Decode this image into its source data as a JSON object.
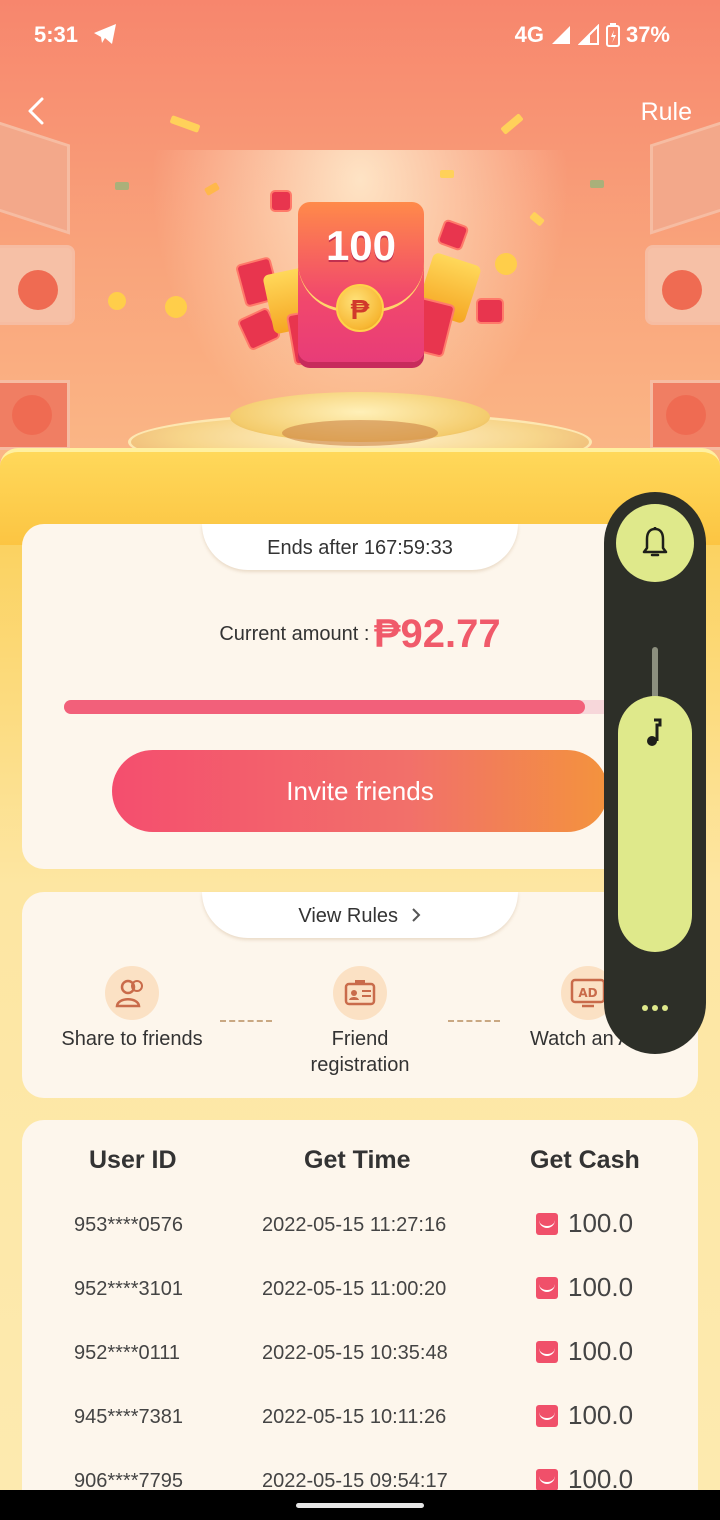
{
  "status_bar": {
    "time": "5:31",
    "network": "4G",
    "battery": "37%"
  },
  "header": {
    "rule_label": "Rule"
  },
  "hero": {
    "envelope_amount": "100",
    "currency_symbol": "₱"
  },
  "countdown": {
    "label": "Ends after  167:59:33"
  },
  "current": {
    "label": "Current amount :",
    "value": "₱92.77",
    "progress_fraction": 0.93
  },
  "invite": {
    "label": "Invite friends"
  },
  "rules": {
    "label": "View Rules",
    "steps": [
      {
        "icon": "users-icon",
        "label": "Share to friends"
      },
      {
        "icon": "id-card-icon",
        "label": "Friend registration"
      },
      {
        "icon": "ad-icon",
        "label": "Watch an AD"
      }
    ]
  },
  "table": {
    "headers": [
      "User ID",
      "Get Time",
      "Get Cash"
    ],
    "rows": [
      {
        "user_id": "953****0576",
        "time": "2022-05-15 11:27:16",
        "cash": "100.0"
      },
      {
        "user_id": "952****3101",
        "time": "2022-05-15 11:00:20",
        "cash": "100.0"
      },
      {
        "user_id": "952****0111",
        "time": "2022-05-15 10:35:48",
        "cash": "100.0"
      },
      {
        "user_id": "945****7381",
        "time": "2022-05-15 10:11:26",
        "cash": "100.0"
      },
      {
        "user_id": "906****7795",
        "time": "2022-05-15 09:54:17",
        "cash": "100.0"
      }
    ]
  },
  "colors": {
    "accent": "#f05a6a",
    "volume_accent": "#dfe98b",
    "panel_bg": "#2d2f28"
  }
}
